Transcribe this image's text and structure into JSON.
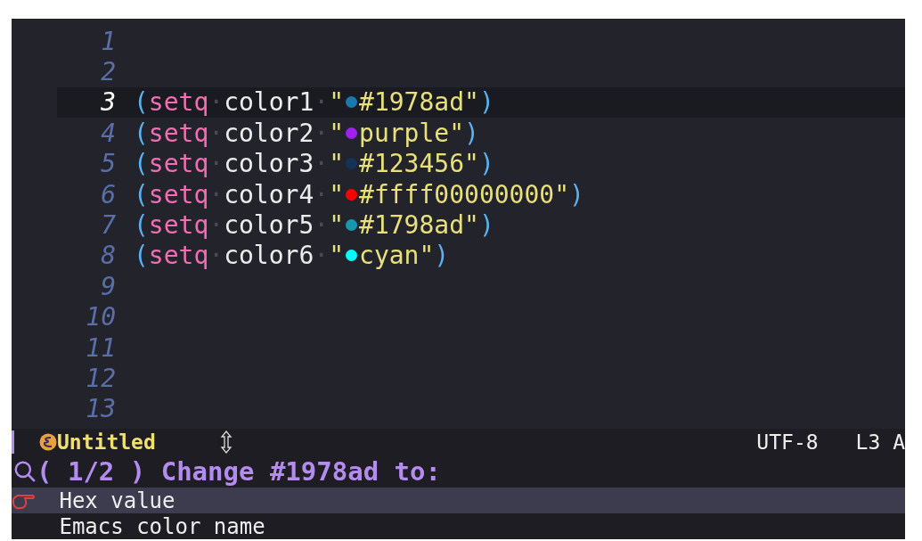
{
  "editor": {
    "lines": [
      {
        "number": "1",
        "current": false
      },
      {
        "number": "2",
        "current": false
      },
      {
        "number": "3",
        "current": true,
        "tokens": [
          {
            "kind": "paren",
            "text": "("
          },
          {
            "kind": "keyword",
            "text": "setq"
          },
          {
            "kind": "space",
            "text": "·"
          },
          {
            "kind": "var",
            "text": "color1"
          },
          {
            "kind": "space",
            "text": "·"
          },
          {
            "kind": "string",
            "text": "\""
          },
          {
            "kind": "swatch",
            "color": "#1978ad"
          },
          {
            "kind": "string",
            "text": "#1978ad\""
          },
          {
            "kind": "paren",
            "text": ")"
          }
        ]
      },
      {
        "number": "4",
        "current": false,
        "tokens": [
          {
            "kind": "paren",
            "text": "("
          },
          {
            "kind": "keyword",
            "text": "setq"
          },
          {
            "kind": "space",
            "text": "·"
          },
          {
            "kind": "var",
            "text": "color2"
          },
          {
            "kind": "space",
            "text": "·"
          },
          {
            "kind": "string",
            "text": "\""
          },
          {
            "kind": "swatch",
            "color": "#a020f0"
          },
          {
            "kind": "string",
            "text": "purple\""
          },
          {
            "kind": "paren",
            "text": ")"
          }
        ]
      },
      {
        "number": "5",
        "current": false,
        "tokens": [
          {
            "kind": "paren",
            "text": "("
          },
          {
            "kind": "keyword",
            "text": "setq"
          },
          {
            "kind": "space",
            "text": "·"
          },
          {
            "kind": "var",
            "text": "color3"
          },
          {
            "kind": "space",
            "text": "·"
          },
          {
            "kind": "string",
            "text": "\""
          },
          {
            "kind": "swatch",
            "color": "#123456"
          },
          {
            "kind": "string",
            "text": "#123456\""
          },
          {
            "kind": "paren",
            "text": ")"
          }
        ]
      },
      {
        "number": "6",
        "current": false,
        "tokens": [
          {
            "kind": "paren",
            "text": "("
          },
          {
            "kind": "keyword",
            "text": "setq"
          },
          {
            "kind": "space",
            "text": "·"
          },
          {
            "kind": "var",
            "text": "color4"
          },
          {
            "kind": "space",
            "text": "·"
          },
          {
            "kind": "string",
            "text": "\""
          },
          {
            "kind": "swatch",
            "color": "#ff0000"
          },
          {
            "kind": "string",
            "text": "#ffff00000000\""
          },
          {
            "kind": "paren",
            "text": ")"
          }
        ]
      },
      {
        "number": "7",
        "current": false,
        "tokens": [
          {
            "kind": "paren",
            "text": "("
          },
          {
            "kind": "keyword",
            "text": "setq"
          },
          {
            "kind": "space",
            "text": "·"
          },
          {
            "kind": "var",
            "text": "color5"
          },
          {
            "kind": "space",
            "text": "·"
          },
          {
            "kind": "string",
            "text": "\""
          },
          {
            "kind": "swatch",
            "color": "#1798ad"
          },
          {
            "kind": "string",
            "text": "#1798ad\""
          },
          {
            "kind": "paren",
            "text": ")"
          }
        ]
      },
      {
        "number": "8",
        "current": false,
        "tokens": [
          {
            "kind": "paren",
            "text": "("
          },
          {
            "kind": "keyword",
            "text": "setq"
          },
          {
            "kind": "space",
            "text": "·"
          },
          {
            "kind": "var",
            "text": "color6"
          },
          {
            "kind": "space",
            "text": "·"
          },
          {
            "kind": "string",
            "text": "\""
          },
          {
            "kind": "swatch",
            "color": "#00ffff"
          },
          {
            "kind": "string",
            "text": "cyan\""
          },
          {
            "kind": "paren",
            "text": ")"
          }
        ]
      },
      {
        "number": "9",
        "current": false
      },
      {
        "number": "10",
        "current": false
      },
      {
        "number": "11",
        "current": false
      },
      {
        "number": "12",
        "current": false
      },
      {
        "number": "13",
        "current": false
      }
    ]
  },
  "mode_line": {
    "buffer_name": "Untitled",
    "encoding": "UTF-8",
    "position": "L3 A"
  },
  "minibuffer": {
    "prompt": "( 1/2 ) Change #1978ad to:",
    "candidates": [
      {
        "label": "Hex value",
        "selected": true
      },
      {
        "label": "Emacs color name",
        "selected": false
      }
    ]
  }
}
